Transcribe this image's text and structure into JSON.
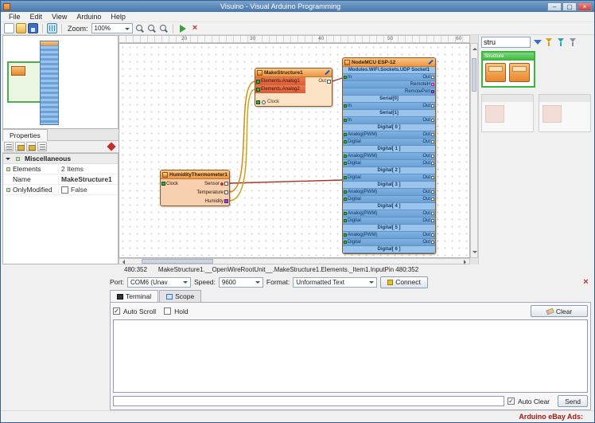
{
  "window": {
    "title": "Visuino - Visual Arduino Programming"
  },
  "menubar": {
    "items": [
      "File",
      "Edit",
      "View",
      "Arduino",
      "Help"
    ]
  },
  "toolbar": {
    "zoom_label": "Zoom:",
    "zoom_value": "100%"
  },
  "left_panel": {
    "properties_tab": "Properties",
    "grid": {
      "category": "Miscellaneous",
      "rows": [
        {
          "label": "Elements",
          "value": "2 Items"
        },
        {
          "label": "Name",
          "value": "MakeStructure1"
        },
        {
          "label": "OnlyModified",
          "value": "False"
        }
      ]
    }
  },
  "ruler": {
    "marks": [
      "20",
      "30",
      "40",
      "50",
      "60"
    ]
  },
  "components": {
    "make_structure": {
      "title": "MakeStructure1",
      "pin1": "Elements.Analog1",
      "pin2": "Elements.Analog2",
      "clock": "Clock",
      "out": "Out"
    },
    "nodemcu": {
      "title": "NodeMCU ESP-12",
      "rows": [
        {
          "t": "label",
          "text": "Modules.WiFi.Sockets.UDP Socket1"
        },
        {
          "t": "pin",
          "l": "In",
          "r": "Out",
          "lp": "green",
          "rp": "white"
        },
        {
          "t": "pin",
          "l": "",
          "r": "RemoteH",
          "lp": "",
          "rp": "pink"
        },
        {
          "t": "pin",
          "l": "",
          "r": "RemotePort",
          "lp": "",
          "rp": "purple"
        },
        {
          "t": "label",
          "text": "Serial[0]"
        },
        {
          "t": "pin",
          "l": "In",
          "r": "Out",
          "lp": "green",
          "rp": "white"
        },
        {
          "t": "label",
          "text": "Serial[1]"
        },
        {
          "t": "pin",
          "l": "In",
          "r": "Out",
          "lp": "green",
          "rp": "white"
        },
        {
          "t": "label",
          "text": "Digital[ 0 ]"
        },
        {
          "t": "pin",
          "l": "Analog(PWM)",
          "r": "Out",
          "lp": "green",
          "rp": "white"
        },
        {
          "t": "pin",
          "l": "Digital",
          "r": "Out",
          "lp": "green",
          "rp": "white"
        },
        {
          "t": "label",
          "text": "Digital[ 1 ]"
        },
        {
          "t": "pin",
          "l": "Analog(PWM)",
          "r": "Out",
          "lp": "green",
          "rp": "white"
        },
        {
          "t": "pin",
          "l": "Digital",
          "r": "Out",
          "lp": "green",
          "rp": "white"
        },
        {
          "t": "label",
          "text": "Digital[ 2 ]"
        },
        {
          "t": "pin",
          "l": "Digital",
          "r": "Out",
          "lp": "green",
          "rp": "white"
        },
        {
          "t": "label",
          "text": "Digital[ 3 ]"
        },
        {
          "t": "pin",
          "l": "Analog(PWM)",
          "r": "Out",
          "lp": "green",
          "rp": "white"
        },
        {
          "t": "pin",
          "l": "Digital",
          "r": "Out",
          "lp": "green",
          "rp": "white"
        },
        {
          "t": "label",
          "text": "Digital[ 4 ]"
        },
        {
          "t": "pin",
          "l": "Analog(PWM)",
          "r": "Out",
          "lp": "green",
          "rp": "white"
        },
        {
          "t": "pin",
          "l": "Digital",
          "r": "Out",
          "lp": "green",
          "rp": "white"
        },
        {
          "t": "label",
          "text": "Digital[ 5 ]"
        },
        {
          "t": "pin",
          "l": "Analog(PWM)",
          "r": "Out",
          "lp": "green",
          "rp": "white"
        },
        {
          "t": "pin",
          "l": "Digital",
          "r": "Out",
          "lp": "green",
          "rp": "white"
        },
        {
          "t": "label",
          "text": "Digital[ 6 ]"
        }
      ]
    },
    "humidity": {
      "title": "HumidityThermometer1",
      "clock": "Clock",
      "sensor": "Sensor",
      "temperature": "Temperature",
      "humidity": "Humidity"
    }
  },
  "status": {
    "coords": "480:352",
    "path": "MakeStructure1.__OpenWireRootUnit__.MakeStructure1.Elements._Item1.InputPin 480:352"
  },
  "connection_bar": {
    "port_label": "Port:",
    "port_value": "COM6 (Unav",
    "speed_label": "Speed:",
    "speed_value": "9600",
    "format_label": "Format:",
    "format_value": "Unformatted Text",
    "connect": "Connect"
  },
  "terminal": {
    "tabs": {
      "terminal": "Terminal",
      "scope": "Scope"
    },
    "auto_scroll": "Auto Scroll",
    "hold": "Hold",
    "clear": "Clear",
    "auto_clear": "Auto Clear",
    "send": "Send"
  },
  "right_panel": {
    "search_value": "stru",
    "palette_selected_title": "Structure"
  },
  "colors": {
    "accent_blue": "#4677ab",
    "component_blue": "#6ba1d6",
    "component_orange": "#ee9440",
    "selection_green": "#3cb53c",
    "wire_red": "#b03028",
    "wire_orange": "#d88818",
    "wire_yellow": "#c8a818"
  },
  "footer": {
    "ads": "Arduino eBay Ads:"
  }
}
